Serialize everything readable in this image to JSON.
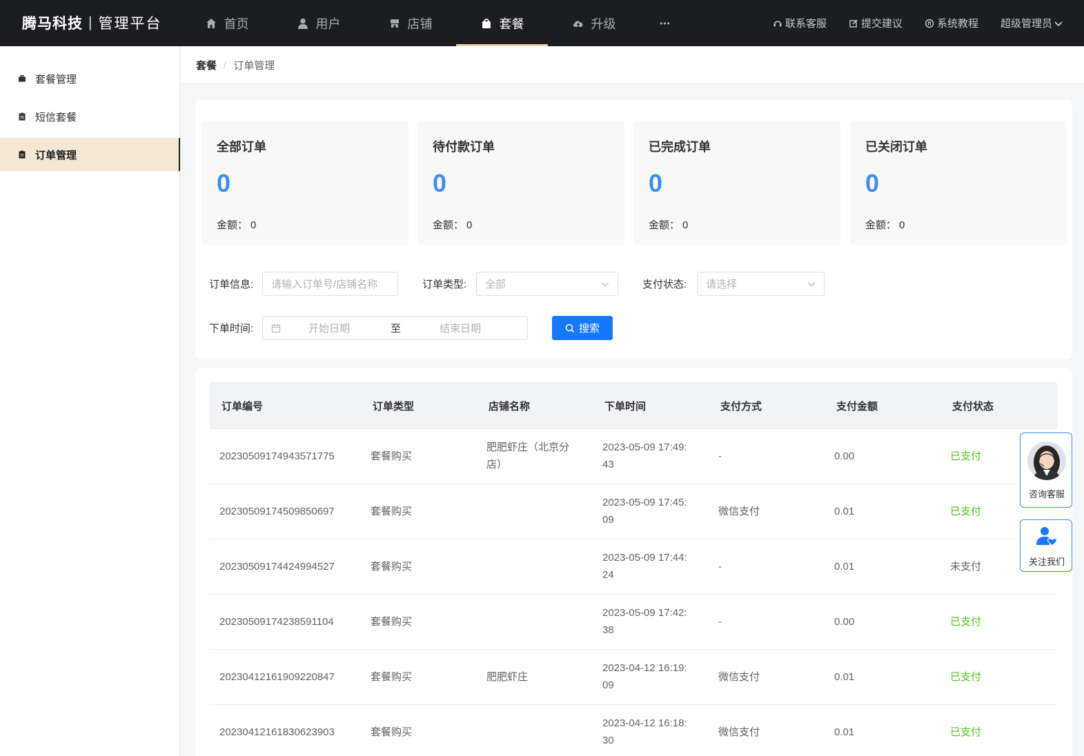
{
  "brand": {
    "name": "腾马科技",
    "separator": "|",
    "subtitle": "管理平台"
  },
  "nav": [
    {
      "label": "首页",
      "icon": "home-icon"
    },
    {
      "label": "用户",
      "icon": "user-icon"
    },
    {
      "label": "店铺",
      "icon": "store-icon"
    },
    {
      "label": "套餐",
      "icon": "bag-icon",
      "active": true
    },
    {
      "label": "升级",
      "icon": "cloud-upload-icon"
    }
  ],
  "nav_more": "•••",
  "top_right": {
    "service": "联系客服",
    "suggest": "提交建议",
    "tutorial": "系统教程",
    "admin": "超级管理员"
  },
  "sidebar": [
    {
      "label": "套餐管理"
    },
    {
      "label": "短信套餐"
    },
    {
      "label": "订单管理",
      "active": true
    }
  ],
  "breadcrumb": {
    "first": "套餐",
    "sep": "/",
    "current": "订单管理"
  },
  "stats": [
    {
      "title": "全部订单",
      "count": "0",
      "amount_label": "金额：",
      "amount": "0"
    },
    {
      "title": "待付款订单",
      "count": "0",
      "amount_label": "金额：",
      "amount": "0"
    },
    {
      "title": "已完成订单",
      "count": "0",
      "amount_label": "金额：",
      "amount": "0"
    },
    {
      "title": "已关闭订单",
      "count": "0",
      "amount_label": "金额：",
      "amount": "0"
    }
  ],
  "filters": {
    "order_info_label": "订单信息:",
    "order_info_placeholder": "请输入订单号/店铺名称",
    "order_type_label": "订单类型:",
    "order_type_value": "全部",
    "pay_status_label": "支付状态:",
    "pay_status_placeholder": "请选择",
    "time_label": "下单时间:",
    "start_placeholder": "开始日期",
    "range_sep": "至",
    "end_placeholder": "结束日期",
    "search_label": "搜索"
  },
  "table": {
    "headers": [
      "订单编号",
      "订单类型",
      "店铺名称",
      "下单时间",
      "支付方式",
      "支付金额",
      "支付状态"
    ],
    "rows": [
      {
        "id": "20230509174943571775",
        "type": "套餐购买",
        "store_l1": "肥肥虾庄（北京分",
        "store_l2": "店）",
        "time_l1": "2023-05-09 17:49:",
        "time_l2": "43",
        "method": "-",
        "amount": "0.00",
        "status": "已支付",
        "paid": true
      },
      {
        "id": "20230509174509850697",
        "type": "套餐购买",
        "store_l1": "",
        "store_l2": "",
        "time_l1": "2023-05-09 17:45:",
        "time_l2": "09",
        "method": "微信支付",
        "amount": "0.01",
        "status": "已支付",
        "paid": true
      },
      {
        "id": "20230509174424994527",
        "type": "套餐购买",
        "store_l1": "",
        "store_l2": "",
        "time_l1": "2023-05-09 17:44:",
        "time_l2": "24",
        "method": "-",
        "amount": "0.01",
        "status": "未支付",
        "paid": false
      },
      {
        "id": "20230509174238591104",
        "type": "套餐购买",
        "store_l1": "",
        "store_l2": "",
        "time_l1": "2023-05-09 17:42:",
        "time_l2": "38",
        "method": "-",
        "amount": "0.00",
        "status": "已支付",
        "paid": true
      },
      {
        "id": "20230412161909220847",
        "type": "套餐购买",
        "store_l1": "肥肥虾庄",
        "store_l2": "",
        "time_l1": "2023-04-12 16:19:",
        "time_l2": "09",
        "method": "微信支付",
        "amount": "0.01",
        "status": "已支付",
        "paid": true
      },
      {
        "id": "20230412161830623903",
        "type": "套餐购买",
        "store_l1": "",
        "store_l2": "",
        "time_l1": "2023-04-12 16:18:",
        "time_l2": "30",
        "method": "微信支付",
        "amount": "0.01",
        "status": "已支付",
        "paid": true
      }
    ]
  },
  "floating": {
    "consult": "咨询客服",
    "follow": "关注我们"
  },
  "colors": {
    "topbar": "#1c1d21",
    "accent_blue": "#1677ff",
    "stat_number": "#3f8cf2",
    "paid_green": "#52c41a",
    "active_side": "#f5e7d3"
  }
}
